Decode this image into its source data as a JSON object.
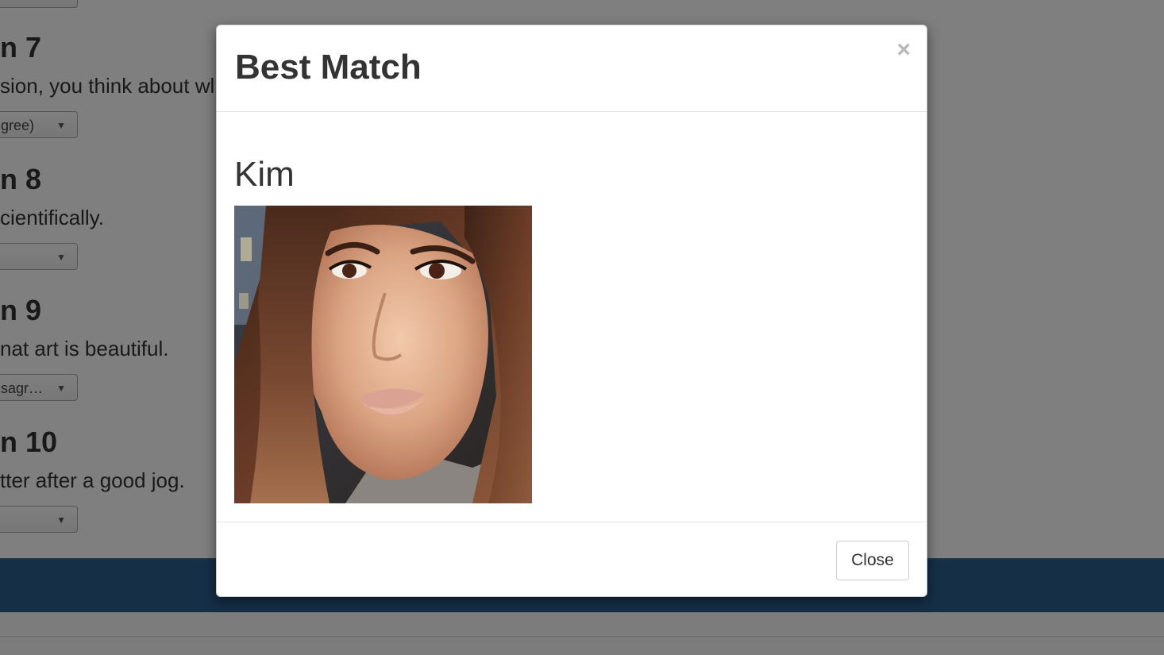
{
  "background": {
    "questions": [
      {
        "title": "n 7",
        "text": "sion, you think about wl",
        "select_value": "gree)"
      },
      {
        "title": "n 8",
        "text": "cientifically.",
        "select_value": ""
      },
      {
        "title": "n 9",
        "text": "nat art is beautiful.",
        "select_value": "sagr…"
      },
      {
        "title": "n 10",
        "text": "tter after a good jog.",
        "select_value": ""
      }
    ],
    "footer_color": "#2b5f8f"
  },
  "modal": {
    "title": "Best Match",
    "close_x": "×",
    "match_name": "Kim",
    "photo_alt": "Kim profile photo",
    "close_button_label": "Close"
  },
  "icons": {
    "dismiss": "close-icon",
    "dropdown": "chevron-down-icon"
  }
}
